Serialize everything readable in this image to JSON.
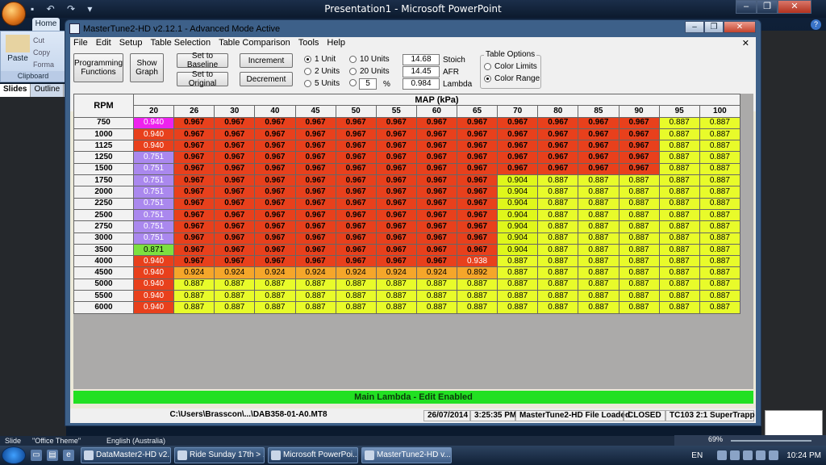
{
  "ppt": {
    "title": "Presentation1 - Microsoft PowerPoint",
    "home_tab": "Home",
    "clipboard": {
      "paste": "Paste",
      "cut": "Cut",
      "copy": "Copy",
      "format": "Forma",
      "label": "Clipboard"
    },
    "slide_tabs": [
      "Slides",
      "Outline"
    ],
    "status": {
      "slide": "Slide",
      "theme": "\"Office Theme\"",
      "lang": "English (Australia)",
      "zoom": "69%"
    }
  },
  "mt": {
    "title": "MasterTune2-HD  v2.12.1 - Advanced Mode Active",
    "menu": [
      "File",
      "Edit",
      "Setup",
      "Table Selection",
      "Table Comparison",
      "Tools",
      "Help"
    ],
    "buttons": {
      "programming": "Programming Functions",
      "show_graph": "Show Graph",
      "set_baseline": "Set to Baseline",
      "set_original": "Set to Original",
      "increment": "Increment",
      "decrement": "Decrement"
    },
    "units": [
      "1 Unit",
      "2 Units",
      "5 Units",
      "10 Units",
      "20 Units"
    ],
    "percent_value": "5",
    "percent_sign": "%",
    "stoich": {
      "value": "14.68",
      "label": "Stoich"
    },
    "afr": {
      "value": "14.45",
      "label": "AFR"
    },
    "lambda": {
      "value": "0.984",
      "label": "Lambda"
    },
    "table_options": {
      "label": "Table Options",
      "color_limits": "Color Limits",
      "color_range": "Color Range"
    },
    "table": {
      "rpm_header": "RPM",
      "map_header": "MAP (kPa)",
      "map_cols": [
        "20",
        "26",
        "30",
        "40",
        "45",
        "50",
        "55",
        "60",
        "65",
        "70",
        "80",
        "85",
        "90",
        "95",
        "100"
      ],
      "rows": [
        {
          "rpm": "750",
          "v": [
            "0.940",
            "0.967",
            "0.967",
            "0.967",
            "0.967",
            "0.967",
            "0.967",
            "0.967",
            "0.967",
            "0.967",
            "0.967",
            "0.967",
            "0.967",
            "0.887",
            "0.887"
          ]
        },
        {
          "rpm": "1000",
          "v": [
            "0.940",
            "0.967",
            "0.967",
            "0.967",
            "0.967",
            "0.967",
            "0.967",
            "0.967",
            "0.967",
            "0.967",
            "0.967",
            "0.967",
            "0.967",
            "0.887",
            "0.887"
          ]
        },
        {
          "rpm": "1125",
          "v": [
            "0.940",
            "0.967",
            "0.967",
            "0.967",
            "0.967",
            "0.967",
            "0.967",
            "0.967",
            "0.967",
            "0.967",
            "0.967",
            "0.967",
            "0.967",
            "0.887",
            "0.887"
          ]
        },
        {
          "rpm": "1250",
          "v": [
            "0.751",
            "0.967",
            "0.967",
            "0.967",
            "0.967",
            "0.967",
            "0.967",
            "0.967",
            "0.967",
            "0.967",
            "0.967",
            "0.967",
            "0.967",
            "0.887",
            "0.887"
          ]
        },
        {
          "rpm": "1500",
          "v": [
            "0.751",
            "0.967",
            "0.967",
            "0.967",
            "0.967",
            "0.967",
            "0.967",
            "0.967",
            "0.967",
            "0.967",
            "0.967",
            "0.967",
            "0.967",
            "0.887",
            "0.887"
          ]
        },
        {
          "rpm": "1750",
          "v": [
            "0.751",
            "0.967",
            "0.967",
            "0.967",
            "0.967",
            "0.967",
            "0.967",
            "0.967",
            "0.967",
            "0.904",
            "0.887",
            "0.887",
            "0.887",
            "0.887",
            "0.887"
          ]
        },
        {
          "rpm": "2000",
          "v": [
            "0.751",
            "0.967",
            "0.967",
            "0.967",
            "0.967",
            "0.967",
            "0.967",
            "0.967",
            "0.967",
            "0.904",
            "0.887",
            "0.887",
            "0.887",
            "0.887",
            "0.887"
          ]
        },
        {
          "rpm": "2250",
          "v": [
            "0.751",
            "0.967",
            "0.967",
            "0.967",
            "0.967",
            "0.967",
            "0.967",
            "0.967",
            "0.967",
            "0.904",
            "0.887",
            "0.887",
            "0.887",
            "0.887",
            "0.887"
          ]
        },
        {
          "rpm": "2500",
          "v": [
            "0.751",
            "0.967",
            "0.967",
            "0.967",
            "0.967",
            "0.967",
            "0.967",
            "0.967",
            "0.967",
            "0.904",
            "0.887",
            "0.887",
            "0.887",
            "0.887",
            "0.887"
          ]
        },
        {
          "rpm": "2750",
          "v": [
            "0.751",
            "0.967",
            "0.967",
            "0.967",
            "0.967",
            "0.967",
            "0.967",
            "0.967",
            "0.967",
            "0.904",
            "0.887",
            "0.887",
            "0.887",
            "0.887",
            "0.887"
          ]
        },
        {
          "rpm": "3000",
          "v": [
            "0.751",
            "0.967",
            "0.967",
            "0.967",
            "0.967",
            "0.967",
            "0.967",
            "0.967",
            "0.967",
            "0.904",
            "0.887",
            "0.887",
            "0.887",
            "0.887",
            "0.887"
          ]
        },
        {
          "rpm": "3500",
          "v": [
            "0.871",
            "0.967",
            "0.967",
            "0.967",
            "0.967",
            "0.967",
            "0.967",
            "0.967",
            "0.967",
            "0.904",
            "0.887",
            "0.887",
            "0.887",
            "0.887",
            "0.887"
          ]
        },
        {
          "rpm": "4000",
          "v": [
            "0.940",
            "0.967",
            "0.967",
            "0.967",
            "0.967",
            "0.967",
            "0.967",
            "0.967",
            "0.938",
            "0.887",
            "0.887",
            "0.887",
            "0.887",
            "0.887",
            "0.887"
          ]
        },
        {
          "rpm": "4500",
          "v": [
            "0.940",
            "0.924",
            "0.924",
            "0.924",
            "0.924",
            "0.924",
            "0.924",
            "0.924",
            "0.892",
            "0.887",
            "0.887",
            "0.887",
            "0.887",
            "0.887",
            "0.887"
          ]
        },
        {
          "rpm": "5000",
          "v": [
            "0.940",
            "0.887",
            "0.887",
            "0.887",
            "0.887",
            "0.887",
            "0.887",
            "0.887",
            "0.887",
            "0.887",
            "0.887",
            "0.887",
            "0.887",
            "0.887",
            "0.887"
          ]
        },
        {
          "rpm": "5500",
          "v": [
            "0.940",
            "0.887",
            "0.887",
            "0.887",
            "0.887",
            "0.887",
            "0.887",
            "0.887",
            "0.887",
            "0.887",
            "0.887",
            "0.887",
            "0.887",
            "0.887",
            "0.887"
          ]
        },
        {
          "rpm": "6000",
          "v": [
            "0.940",
            "0.887",
            "0.887",
            "0.887",
            "0.887",
            "0.887",
            "0.887",
            "0.887",
            "0.887",
            "0.887",
            "0.887",
            "0.887",
            "0.887",
            "0.887",
            "0.887"
          ]
        }
      ]
    },
    "banner": "Main Lambda - Edit Enabled",
    "statusbar": {
      "file": "C:\\Users\\Brasscon\\...\\DAB358-01-A0.MT8",
      "date": "26/07/2014",
      "time": "3:25:35 PM",
      "loaded": "MasterTune2-HD File Loaded",
      "state": "CLOSED",
      "device": "TC103 2:1 SuperTrapp"
    }
  },
  "taskbar": {
    "items": [
      "DataMaster2-HD  v2...",
      "Ride Sunday 17th > ...",
      "Microsoft PowerPoi...",
      "MasterTune2-HD  v..."
    ],
    "lang": "EN",
    "clock": "10:24 PM"
  },
  "colors": {
    "red": "#e8401c",
    "yellow": "#dff71b",
    "orange": "#f5a62a",
    "purple": "#aa88ee",
    "magenta": "#ee22ee",
    "green": "#7de040",
    "banner": "#22e022"
  }
}
